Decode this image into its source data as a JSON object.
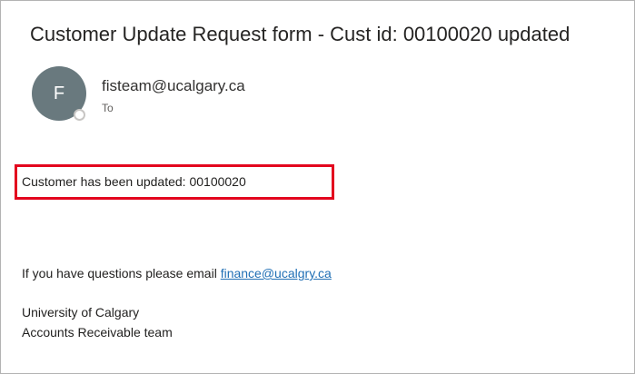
{
  "email": {
    "subject": "Customer Update Request form - Cust id: 00100020 updated",
    "sender": {
      "initial": "F",
      "address": "fisteam@ucalgary.ca",
      "to_label": "To",
      "avatar_color": "#69797e"
    },
    "body": {
      "updated_line": "Customer has been updated: 00100020",
      "questions_prefix": "If you have questions please email ",
      "questions_link": "finance@ucalgry.ca",
      "signature_line1": "University of Calgary",
      "signature_line2": "Accounts Receivable team"
    },
    "highlight_color": "#e3061e",
    "link_color": "#1f6fb5"
  }
}
